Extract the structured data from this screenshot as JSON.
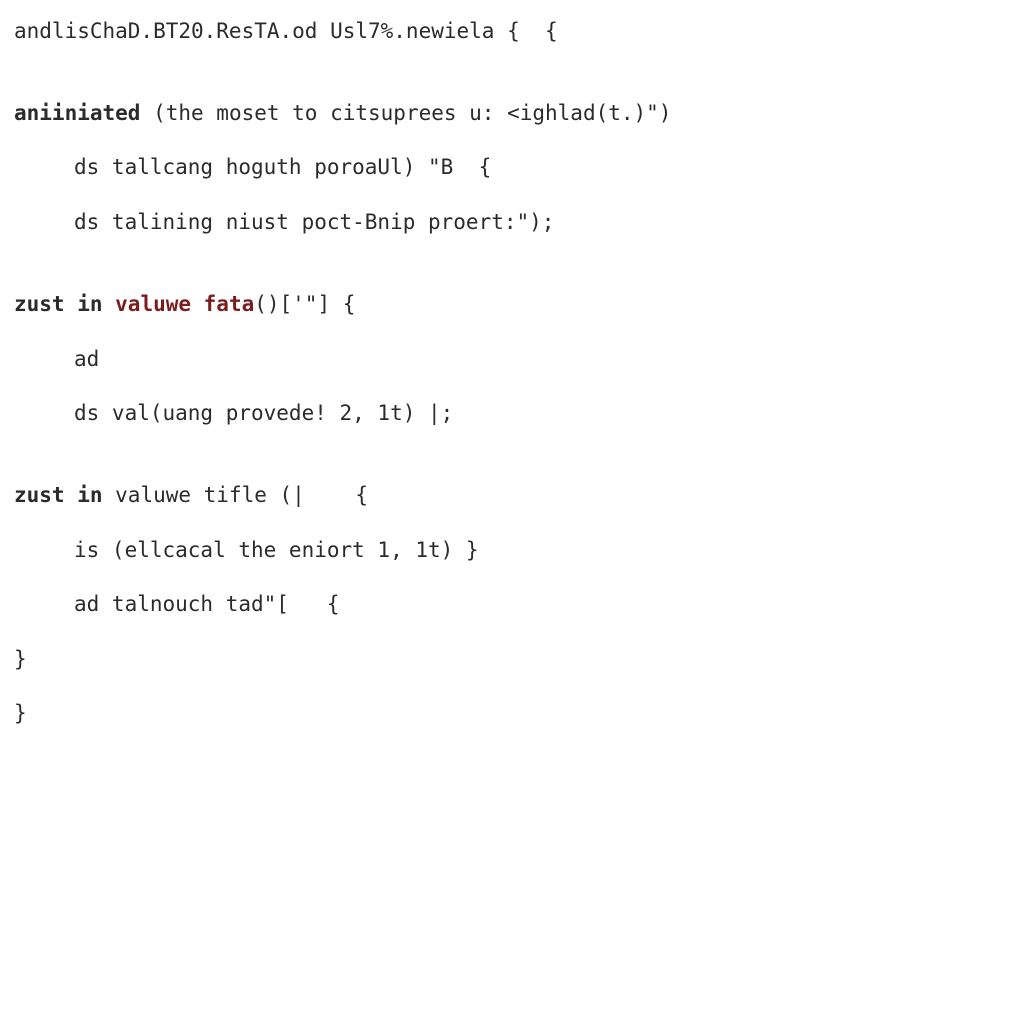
{
  "code": {
    "l1_a": "andlisChaD.BT20.ResTA.od Usl7%.newiela {  {",
    "l2_blank": "",
    "l3_kw": "aniiniated",
    "l3_rest": " (the moset to citsuprees u: <ighlad(t.)\")",
    "l4": "ds tallcang hoguth poroaUl) \"B  {",
    "l5": "ds talining niust poct-Bnip proert:\");",
    "l6_blank": "",
    "l7_kw": "zust in",
    "l7_fn": " valuwe fata",
    "l7_rest": "()['\"] {",
    "l8": "ad",
    "l9": "ds val(uang provede! 2, 1t) |;",
    "l10_blank": "",
    "l11_kw": "zust in",
    "l11_txt": " valuwe tifle ",
    "l11_rest": "(|    {",
    "l12": "is (ellcacal the eniort 1, 1t) }",
    "l13": "ad talnouch tad\"[   {",
    "l14": "}",
    "l15": "}"
  }
}
